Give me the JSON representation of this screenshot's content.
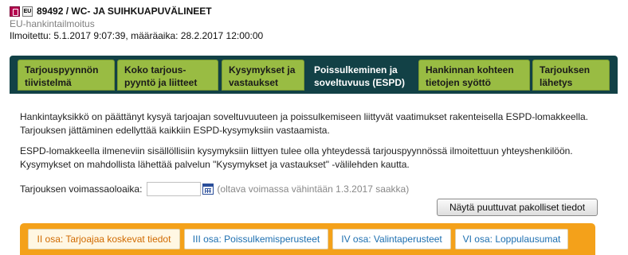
{
  "header": {
    "title": "89492 / WC- JA SUIHKUAPUVÄLINEET",
    "notice_type": "EU-hankintailmoitus",
    "dates": "Ilmoitettu: 5.1.2017 9:07:39, määräaika: 28.2.2017 12:00:00",
    "icons": [
      "pdf-icon",
      "eu-icon"
    ]
  },
  "main_tabs": [
    {
      "label": "Tarjouspyynnön tiivistelmä",
      "active": false
    },
    {
      "label": "Koko tarjous-pyyntö ja liitteet",
      "active": false
    },
    {
      "label": "Kysymykset ja vastaukset",
      "active": false
    },
    {
      "label": "Poissulkeminen ja soveltuvuus (ESPD)",
      "active": true
    },
    {
      "label": "Hankinnan kohteen tietojen syöttö",
      "active": false
    },
    {
      "label": "Tarjouksen lähetys",
      "active": false
    }
  ],
  "content": {
    "paragraph1": "Hankintayksikkö on päättänyt kysyä tarjoajan soveltuvuuteen ja poissulkemiseen liittyvät vaatimukset rakenteisella ESPD-lomakkeella. Tarjouksen jättäminen edellyttää kaikkiin ESPD-kysymyksiin vastaamista.",
    "paragraph2": "ESPD-lomakkeella ilmeneviin sisällöllisiin kysymyksiin liittyen tulee olla yhteydessä tarjouspyynnössä ilmoitettuun yhteyshenkilöön. Kysymykset on mahdollista lähettää palvelun \"Kysymykset ja vastaukset\" -välilehden kautta."
  },
  "validity": {
    "label": "Tarjouksen voimassaoloaika:",
    "value": "",
    "hint": "(oltava voimassa vähintään 1.3.2017 saakka)"
  },
  "missing_button": "Näytä puuttuvat pakolliset tiedot",
  "part_tabs": [
    {
      "label": "II osa: Tarjoajaa koskevat tiedot",
      "active": true
    },
    {
      "label": "III osa: Poissulkemisperusteet",
      "active": false
    },
    {
      "label": "IV osa: Valintaperusteet",
      "active": false
    },
    {
      "label": "VI osa: Loppulausumat",
      "active": false
    }
  ],
  "colors": {
    "nav_dark": "#124146",
    "nav_tab": "#99bc43",
    "part_bar": "#f4a11a",
    "part_link": "#1d6fb0",
    "part_active": "#d06a00"
  }
}
